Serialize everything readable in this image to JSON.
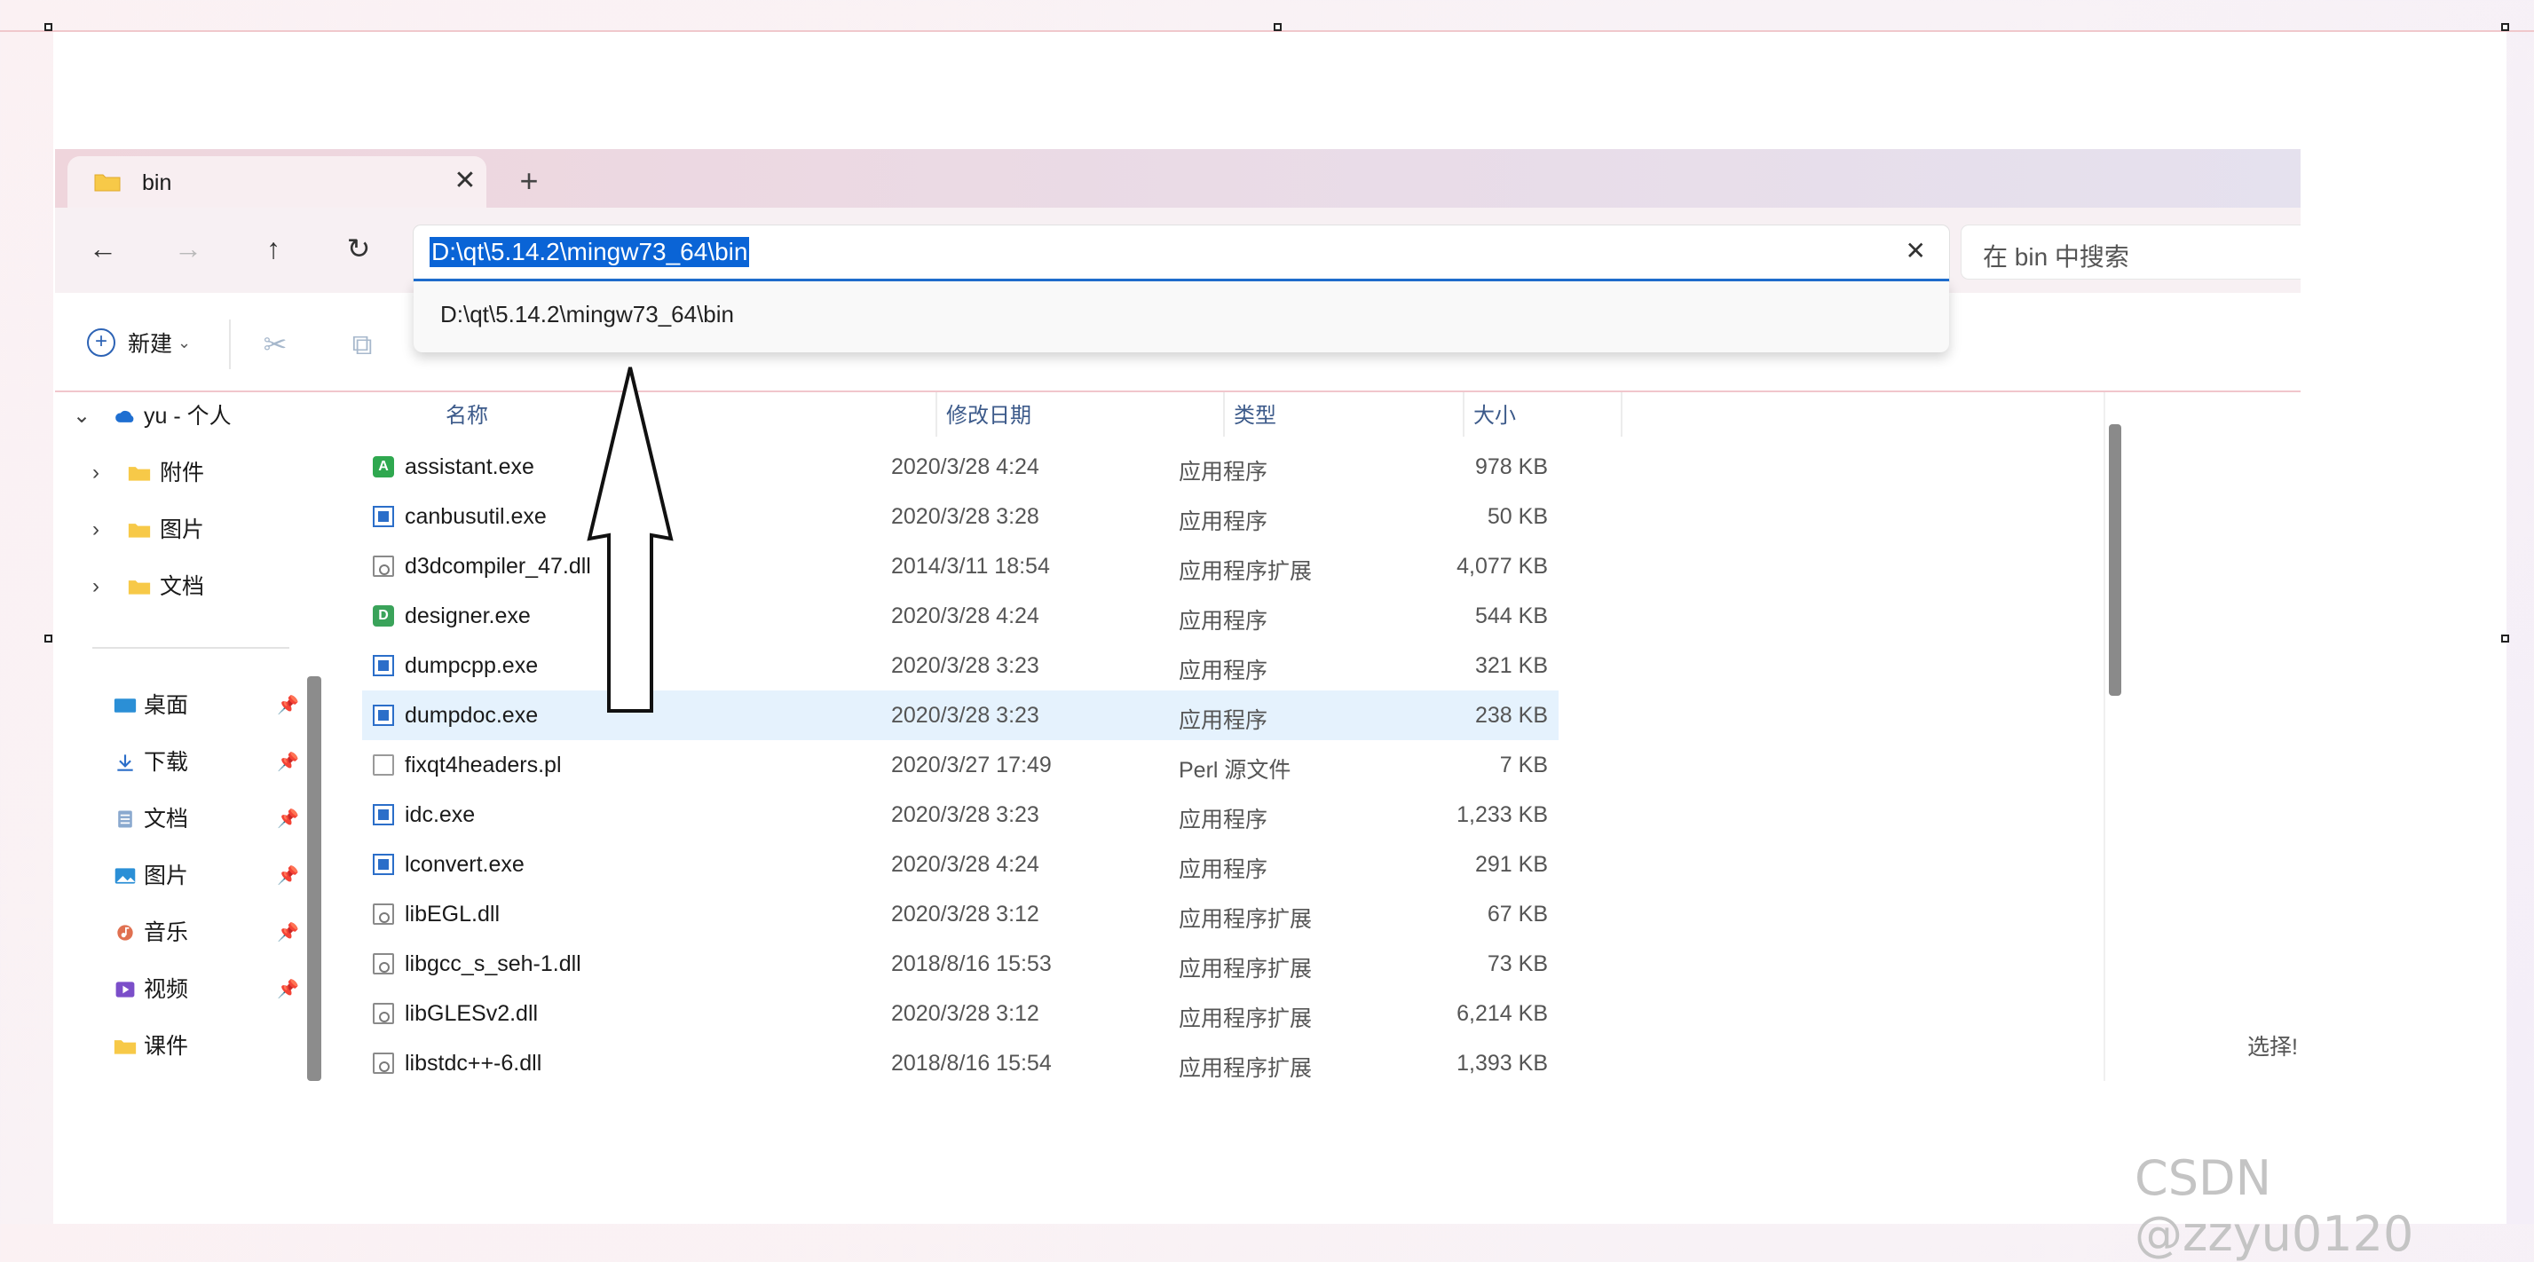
{
  "tab": {
    "title": "bin",
    "close": "✕",
    "new_tab": "+"
  },
  "nav": {
    "back": "←",
    "forward": "→",
    "up": "↑",
    "refresh": "↻",
    "address": "D:\\qt\\5.14.2\\mingw73_64\\bin",
    "address_clear": "✕",
    "search_placeholder": "在 bin 中搜索"
  },
  "suggestion": {
    "text": "D:\\qt\\5.14.2\\mingw73_64\\bin"
  },
  "toolbar": {
    "new_label": "新建",
    "new_chevron": "⌄",
    "cut_icon": "✂",
    "copy_icon": "⧉"
  },
  "sidebar": {
    "root": {
      "label": "yu - 个人",
      "chevron": "⌄"
    },
    "folders": [
      {
        "label": "附件",
        "chevron": "›"
      },
      {
        "label": "图片",
        "chevron": "›"
      },
      {
        "label": "文档",
        "chevron": "›"
      }
    ],
    "quick": [
      {
        "label": "桌面",
        "icon": "desktop-icon",
        "pin": "📌"
      },
      {
        "label": "下载",
        "icon": "download-icon",
        "pin": "📌"
      },
      {
        "label": "文档",
        "icon": "document-icon",
        "pin": "📌"
      },
      {
        "label": "图片",
        "icon": "pictures-icon",
        "pin": "📌"
      },
      {
        "label": "音乐",
        "icon": "music-icon",
        "pin": "📌"
      },
      {
        "label": "视频",
        "icon": "video-icon",
        "pin": "📌"
      },
      {
        "label": "课件",
        "icon": "folder-icon",
        "pin": ""
      }
    ]
  },
  "columns": {
    "name": "名称",
    "date": "修改日期",
    "type": "类型",
    "size": "大小"
  },
  "files": [
    {
      "name": "assistant.exe",
      "date": "2020/3/28 4:24",
      "type": "应用程序",
      "size": "978 KB",
      "icon": "assistant-icon",
      "glyph": "A"
    },
    {
      "name": "canbusutil.exe",
      "date": "2020/3/28 3:28",
      "type": "应用程序",
      "size": "50 KB",
      "icon": "app-icon"
    },
    {
      "name": "d3dcompiler_47.dll",
      "date": "2014/3/11 18:54",
      "type": "应用程序扩展",
      "size": "4,077 KB",
      "icon": "dll-icon"
    },
    {
      "name": "designer.exe",
      "date": "2020/3/28 4:24",
      "type": "应用程序",
      "size": "544 KB",
      "icon": "designer-icon",
      "glyph": "D"
    },
    {
      "name": "dumpcpp.exe",
      "date": "2020/3/28 3:23",
      "type": "应用程序",
      "size": "321 KB",
      "icon": "app-icon"
    },
    {
      "name": "dumpdoc.exe",
      "date": "2020/3/28 3:23",
      "type": "应用程序",
      "size": "238 KB",
      "icon": "app-icon",
      "selected": true
    },
    {
      "name": "fixqt4headers.pl",
      "date": "2020/3/27 17:49",
      "type": "Perl 源文件",
      "size": "7 KB",
      "icon": "text-file-icon"
    },
    {
      "name": "idc.exe",
      "date": "2020/3/28 3:23",
      "type": "应用程序",
      "size": "1,233 KB",
      "icon": "app-icon"
    },
    {
      "name": "lconvert.exe",
      "date": "2020/3/28 4:24",
      "type": "应用程序",
      "size": "291 KB",
      "icon": "app-icon"
    },
    {
      "name": "libEGL.dll",
      "date": "2020/3/28 3:12",
      "type": "应用程序扩展",
      "size": "67 KB",
      "icon": "dll-icon"
    },
    {
      "name": "libgcc_s_seh-1.dll",
      "date": "2018/8/16 15:53",
      "type": "应用程序扩展",
      "size": "73 KB",
      "icon": "dll-icon"
    },
    {
      "name": "libGLESv2.dll",
      "date": "2020/3/28 3:12",
      "type": "应用程序扩展",
      "size": "6,214 KB",
      "icon": "dll-icon"
    },
    {
      "name": "libstdc++-6.dll",
      "date": "2018/8/16 15:54",
      "type": "应用程序扩展",
      "size": "1,393 KB",
      "icon": "dll-icon"
    }
  ],
  "status": {
    "right_text": "选择! "
  },
  "watermark": "CSDN @zzyu0120",
  "colors": {
    "accent": "#0a64d6",
    "selection": "#e5f2fd",
    "folder": "#f7c948"
  }
}
